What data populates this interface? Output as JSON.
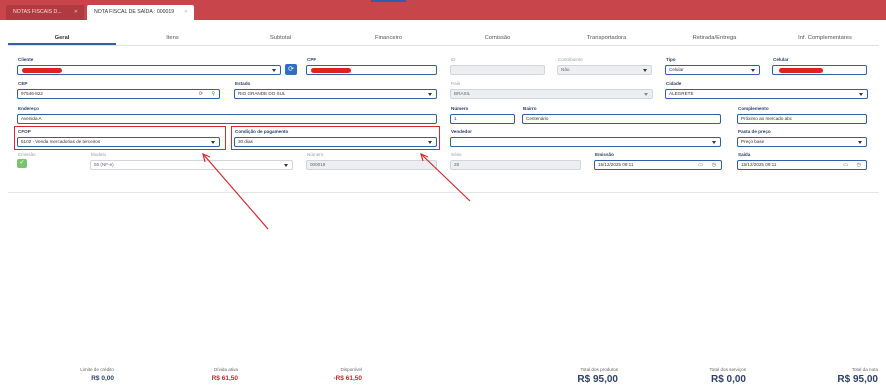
{
  "top_tabs": [
    {
      "label": "NOTAS FISCAIS D..."
    },
    {
      "label": "NOTA FISCAL DE SAÍDA : 000019"
    }
  ],
  "nav_tabs": [
    "Geral",
    "Itens",
    "Subtotal",
    "Financeiro",
    "Comissão",
    "Transportadora",
    "Retirada/Entrega",
    "Inf. Complementares"
  ],
  "form": {
    "cliente_label": "Cliente",
    "cpf_label": "CPF",
    "id_label": "ID",
    "contribuinte_label": "Contribuinte",
    "contribuinte_value": "Não",
    "tipo_label": "Tipo",
    "tipo_value": "Celular",
    "celular_label": "Celular",
    "cep_label": "CEP",
    "cep_value": "97546-822",
    "estado_label": "Estado",
    "estado_value": "RIO GRANDE DO SUL",
    "pais_label": "País",
    "pais_value": "BRASIL",
    "cidade_label": "Cidade",
    "cidade_value": "ALEGRETE",
    "endereco_label": "Endereço",
    "endereco_value": "Avenida A",
    "numero_label": "Número",
    "numero_value": "1",
    "bairro_label": "Bairro",
    "bairro_value": "Centenário",
    "complemento_label": "Complemento",
    "complemento_value": "Próximo ao mercado abc",
    "cfop_label": "CFOP",
    "cfop_value": "5102 - Venda mercadorias de terceiros",
    "condicao_label": "Condição de pagamento",
    "condicao_value": "30 dias",
    "vendedor_label": "Vendedor",
    "pasta_label": "Pasta de preço",
    "pasta_value": "Preço base",
    "emissao_flag_label": "Emissão",
    "modelo_label": "Modelo",
    "modelo_value": "55 (NF-e)",
    "numero_nf_label": "Número",
    "numero_nf_value": "000019",
    "serie_label": "Série",
    "serie_value": "28",
    "emissao_label": "Emissão",
    "emissao_value": "15/12/2025 09:11",
    "saida_label": "Saída",
    "saida_value": "15/12/2025 09:11"
  },
  "icons": {
    "refresh": "refresh-icon",
    "checkbox": "checkmark-icon",
    "calendar": "calendar-icon",
    "clock": "clock-icon",
    "location": "location-pin-icon",
    "caret": "chevron-down-icon"
  },
  "footer": {
    "limite_label": "Limite de crédito",
    "limite_value": "R$ 0,00",
    "divida_label": "Dívida ativa",
    "divida_value": "R$ 61,50",
    "disponivel_label": "Disponível",
    "disponivel_value": "-R$ 61,50",
    "produtos_label": "Total dos produtos",
    "produtos_value": "R$ 95,00",
    "servicos_label": "Total dos serviços",
    "servicos_value": "R$ 0,00",
    "nota_label": "Total da nota",
    "nota_value": "R$ 95,00"
  },
  "colors": {
    "header": "#c8464b",
    "accent": "#2e5fa8",
    "annotation": "#e0262b",
    "negative": "#d0262b"
  }
}
